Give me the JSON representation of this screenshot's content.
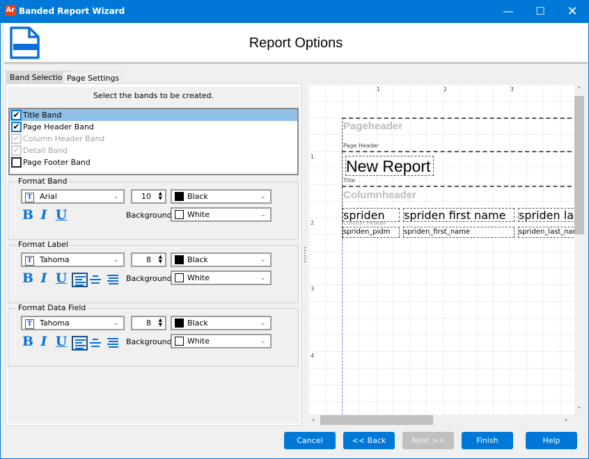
{
  "window": {
    "title": "Banded Report Wizard",
    "logo": "Ar",
    "controls": [
      "minimize-icon",
      "maximize-icon",
      "close-icon"
    ]
  },
  "header": {
    "title": "Report Options",
    "icon": "report-document-icon"
  },
  "tabs": [
    {
      "label": "Band Selection",
      "selected": true
    },
    {
      "label": "Page Settings",
      "selected": false
    }
  ],
  "band_selection": {
    "instruction": "Select the bands to be created.",
    "bands": [
      {
        "label": "Title Band",
        "checked": true,
        "enabled": true,
        "selected": true
      },
      {
        "label": "Page Header Band",
        "checked": true,
        "enabled": true
      },
      {
        "label": "Column Header Band",
        "checked": true,
        "enabled": false
      },
      {
        "label": "Detail Band",
        "checked": true,
        "enabled": false
      },
      {
        "label": "Page Footer Band",
        "checked": false,
        "enabled": true
      }
    ]
  },
  "groups": [
    {
      "title": "Format Band",
      "font": "Arial",
      "size": "10",
      "color": "Black",
      "background_label": "Background",
      "background": "White",
      "alignment": null
    },
    {
      "title": "Format Label",
      "font": "Tahoma",
      "size": "8",
      "color": "Black",
      "background_label": "Background",
      "background": "White",
      "alignment": "left"
    },
    {
      "title": "Format Data Field",
      "font": "Tahoma",
      "size": "8",
      "color": "Black",
      "background_label": "Background",
      "background": "White",
      "alignment": "left"
    }
  ],
  "format_buttons": {
    "bold": "B",
    "italic": "I",
    "underline": "U"
  },
  "preview": {
    "ruler_h": [
      "1",
      "2",
      "3"
    ],
    "ruler_v": [
      "1",
      "2",
      "3",
      "4"
    ],
    "pageheader_band": {
      "caption": "Pageheader",
      "label": "Page Header"
    },
    "title_band": {
      "text": "New Report",
      "label": "Title"
    },
    "columnheader_band": {
      "caption": "Columnheader",
      "label": "Column Header"
    },
    "column_labels": [
      "spriden",
      "spriden first name",
      "spriden last name"
    ],
    "data_fields": [
      "spriden_pidm",
      "spriden_first_name",
      "spriden_last_name"
    ]
  },
  "buttons": {
    "cancel": "Cancel",
    "back": "<< Back",
    "next": "Next >>",
    "finish": "Finish",
    "help": "Help"
  },
  "colors": {
    "accent": "#0078d7",
    "selection": "#90c0e8",
    "disabled_button": "#c0c0c0"
  }
}
